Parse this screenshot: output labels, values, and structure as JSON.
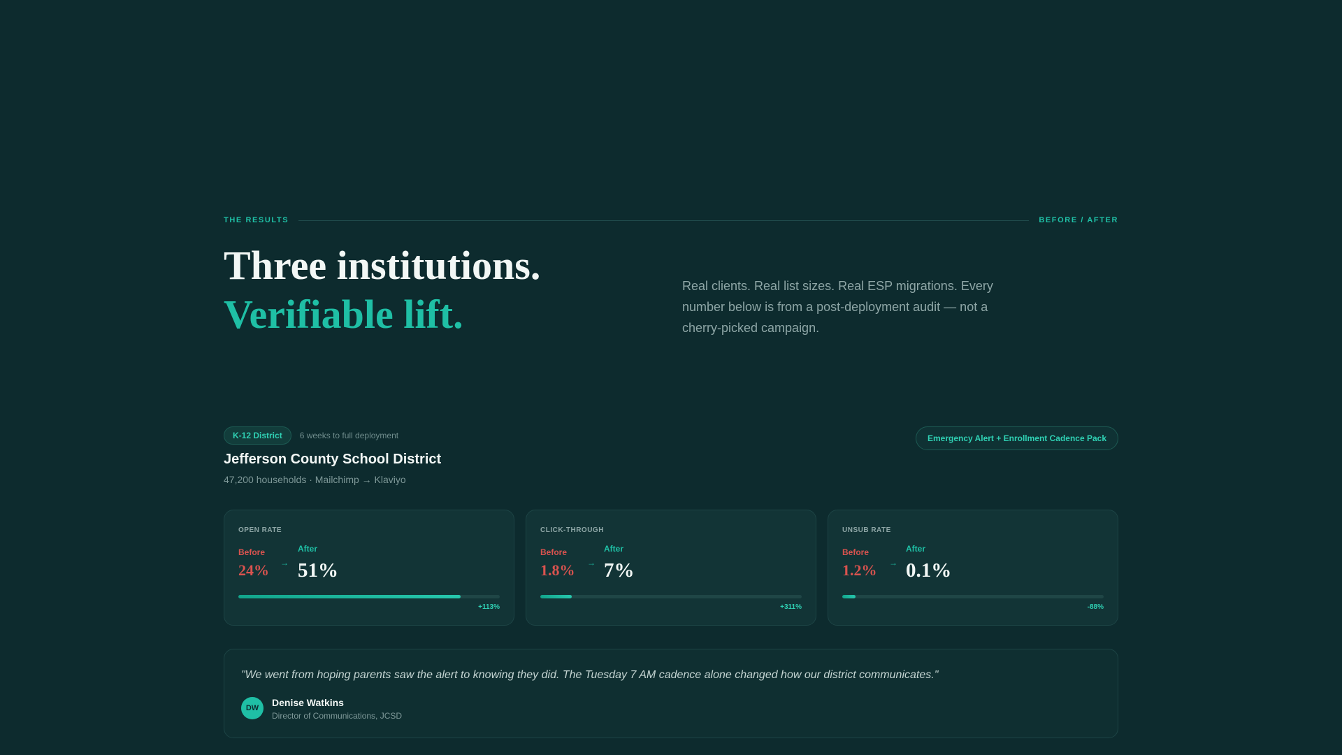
{
  "section": {
    "eyebrow_left": "THE RESULTS",
    "eyebrow_right": "BEFORE / AFTER",
    "headline_line1": "Three institutions.",
    "headline_line2": "Verifiable lift.",
    "intro": "Real clients. Real list sizes. Real ESP migrations. Every number below is from a post-deployment audit — not a cherry-picked campaign."
  },
  "case": {
    "category_chip": "K-12 District",
    "timeline": "6 weeks to full deployment",
    "pack_badge": "Emergency Alert + Enrollment Cadence Pack",
    "client_name": "Jefferson County School District",
    "client_meta": "47,200 households · Mailchimp → Klaviyo"
  },
  "metrics": [
    {
      "label": "OPEN RATE",
      "before_label": "Before",
      "before": "24%",
      "after_label": "After",
      "after": "51%",
      "delta": "+113%",
      "fill": 0.85
    },
    {
      "label": "CLICK-THROUGH",
      "before_label": "Before",
      "before": "1.8%",
      "after_label": "After",
      "after": "7%",
      "delta": "+311%",
      "fill": 0.12
    },
    {
      "label": "UNSUB RATE",
      "before_label": "Before",
      "before": "1.2%",
      "after_label": "After",
      "after": "0.1%",
      "delta": "-88%",
      "fill": 0.05
    }
  ],
  "arrow_glyph": "→",
  "quote": {
    "text": "\"We went from hoping parents saw the alert to knowing they did. The Tuesday 7 AM cadence alone changed how our district communicates.\"",
    "initials": "DW",
    "name": "Denise Watkins",
    "role": "Director of Communications, JCSD"
  },
  "colors": {
    "background": "#0d2b2e",
    "accent": "#1fbfa5",
    "before": "#d9534f"
  }
}
